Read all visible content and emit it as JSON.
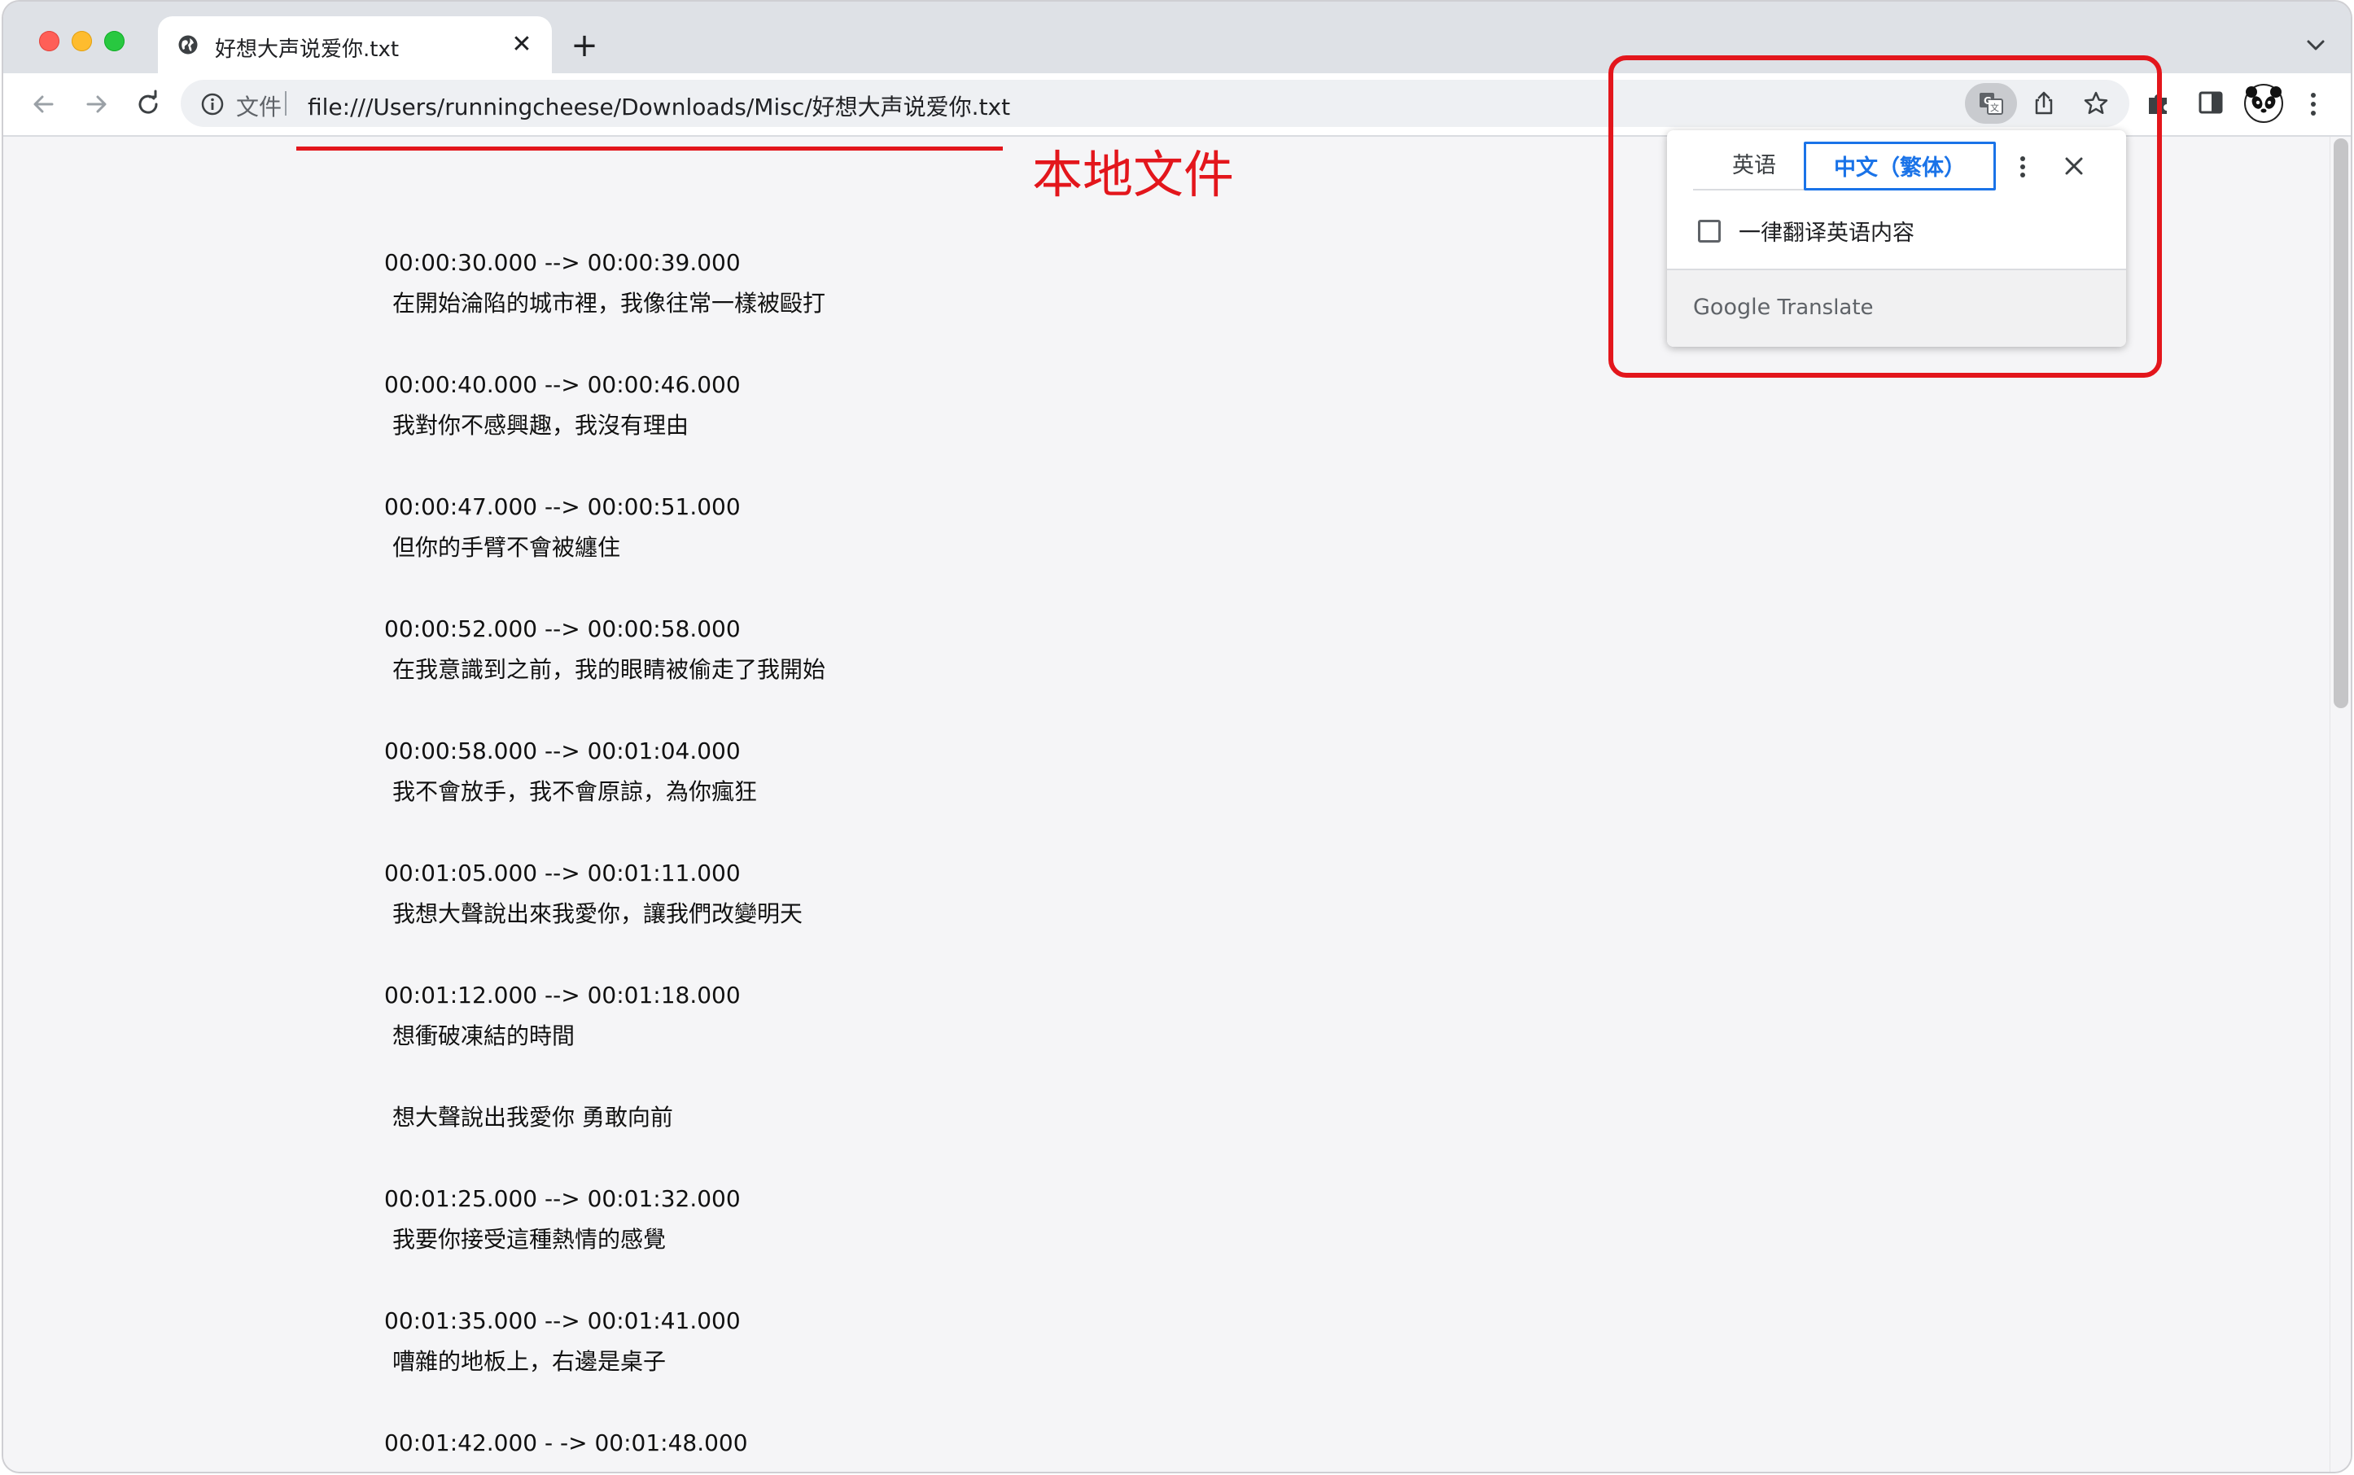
{
  "tab": {
    "title": "好想大声说爱你.txt",
    "close_glyph": "✕",
    "new_tab_glyph": "+"
  },
  "toolbar": {
    "scheme_label": "文件",
    "url": "file:///Users/runningcheese/Downloads/Misc/好想大声说爱你.txt"
  },
  "annotation": {
    "label": "本地文件",
    "color": "#e3161c"
  },
  "translate_popup": {
    "source_lang": "英语",
    "target_lang": "中文（繁体）",
    "always_translate_label": "一律翻译英语内容",
    "always_translate_checked": false,
    "brand_google": "Google",
    "brand_translate": "Translate",
    "accent_color": "#1a73e8"
  },
  "subtitles": [
    {
      "time": "00:00:30.000 --> 00:00:39.000",
      "text": "在開始淪陷的城市裡，我像往常一樣被毆打"
    },
    {
      "time": "00:00:40.000 --> 00:00:46.000",
      "text": "我對你不感興趣，我沒有理由"
    },
    {
      "time": "00:00:47.000 --> 00:00:51.000",
      "text": "但你的手臂不會被纏住"
    },
    {
      "time": "00:00:52.000 --> 00:00:58.000",
      "text": "在我意識到之前，我的眼睛被偷走了我開始"
    },
    {
      "time": "00:00:58.000 --> 00:01:04.000",
      "text": "我不會放手，我不會原諒，為你瘋狂"
    },
    {
      "time": "00:01:05.000 --> 00:01:11.000",
      "text": "我想大聲說出來我愛你，讓我們改變明天"
    },
    {
      "time": "00:01:12.000 --> 00:01:18.000",
      "text": "想衝破凍結的時間"
    },
    {
      "time": "",
      "text": "想大聲說出我愛你 勇敢向前"
    },
    {
      "time": "00:01:25.000 --> 00:01:32.000",
      "text": "我要你接受這種熱情的感覺"
    },
    {
      "time": "00:01:35.000 --> 00:01:41.000",
      "text": "嘈雜的地板上，右邊是桌子"
    },
    {
      "time": "00:01:42.000 - -> 00:01:48.000",
      "text": ""
    }
  ],
  "icons": {
    "tab": "globe-icon",
    "back": "arrow-left-icon",
    "forward": "arrow-right-icon",
    "reload": "reload-icon",
    "info": "info-icon",
    "translate": "translate-icon",
    "share": "share-icon",
    "bookmark": "star-icon",
    "extensions": "puzzle-icon",
    "side_panel": "side-panel-icon",
    "profile": "panda-avatar-icon",
    "menu": "kebab-menu-icon"
  }
}
